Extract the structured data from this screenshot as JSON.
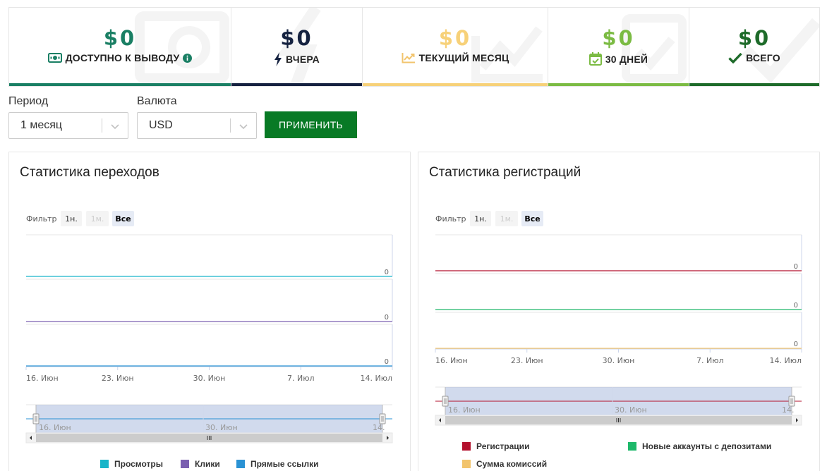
{
  "stats": [
    {
      "amount": "$0",
      "label": "ДОСТУПНО К ВЫВОДУ",
      "color": "#1a7f64",
      "icon": "money-bill-icon",
      "info_icon": "info-circle-icon"
    },
    {
      "amount": "$0",
      "label": "ВЧЕРА",
      "color": "#152240",
      "icon": "lightning-bolt-icon"
    },
    {
      "amount": "$0",
      "label": "ТЕКУЩИЙ МЕСЯЦ",
      "color": "#f7d179",
      "icon": "trend-chart-icon"
    },
    {
      "amount": "$0",
      "label": "30 ДНЕЙ",
      "color": "#7bbb43",
      "icon": "calendar-check-icon"
    },
    {
      "amount": "$0",
      "label": "ВСЕГО",
      "color": "#1e6b2a",
      "icon": "checkmark-icon"
    }
  ],
  "filters": {
    "period_label": "Период",
    "period_value": "1 месяц",
    "currency_label": "Валюта",
    "currency_value": "USD",
    "apply_label": "ПРИМЕНИТЬ"
  },
  "panels": {
    "transitions": {
      "title": "Статистика переходов",
      "filter_label": "Фильтр",
      "range_buttons": [
        "1н.",
        "1м.",
        "Все"
      ],
      "selected_range": "Все",
      "navigator_labels": [
        "16. Июн",
        "30. Июн",
        "14."
      ]
    },
    "registrations": {
      "title": "Статистика регистраций",
      "filter_label": "Фильтр",
      "range_buttons": [
        "1н.",
        "1м.",
        "Все"
      ],
      "selected_range": "Все",
      "navigator_labels": [
        "16. Июн",
        "30. Июн",
        "14."
      ]
    }
  },
  "chart_data": [
    {
      "type": "line",
      "title": "Статистика переходов",
      "x": [
        "16. Июн",
        "23. Июн",
        "30. Июн",
        "7. Июл",
        "14. Июл"
      ],
      "series": [
        {
          "name": "Просмотры",
          "color": "#18b5c9",
          "values": [
            0,
            0,
            0,
            0,
            0
          ]
        },
        {
          "name": "Клики",
          "color": "#7a5fb0",
          "values": [
            0,
            0,
            0,
            0,
            0
          ]
        },
        {
          "name": "Прямые ссылки",
          "color": "#2a92d4",
          "values": [
            0,
            0,
            0,
            0,
            0
          ]
        }
      ],
      "y_tick": "0",
      "legend_position": "bottom"
    },
    {
      "type": "line",
      "title": "Статистика регистраций",
      "x": [
        "16. Июн",
        "23. Июн",
        "30. Июн",
        "7. Июл",
        "14. Июл"
      ],
      "series": [
        {
          "name": "Регистрации",
          "color": "#b3112d",
          "values": [
            0,
            0,
            0,
            0,
            0
          ]
        },
        {
          "name": "Новые аккаунты с депозитами",
          "color": "#1db86a",
          "values": [
            0,
            0,
            0,
            0,
            0
          ]
        },
        {
          "name": "Сумма комиссий",
          "color": "#f2c46d",
          "values": [
            0,
            0,
            0,
            0,
            0
          ]
        }
      ],
      "y_tick": "0",
      "legend_position": "bottom"
    }
  ]
}
